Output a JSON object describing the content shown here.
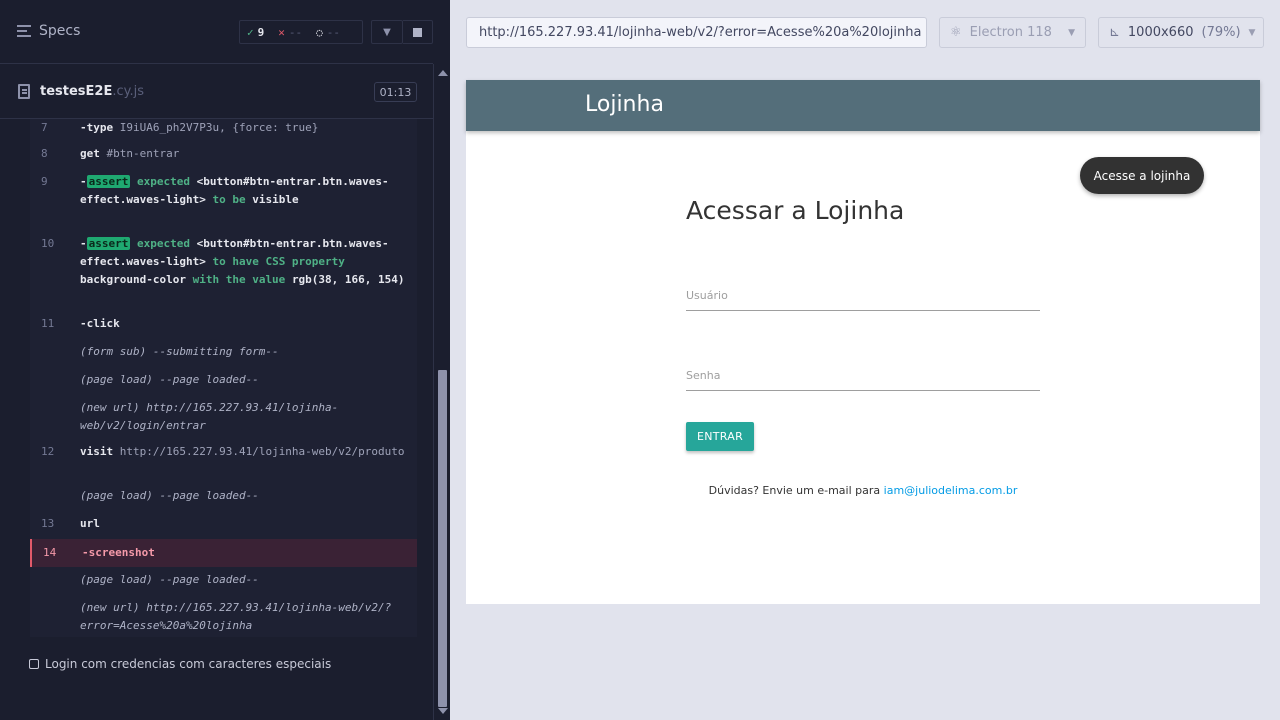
{
  "runner": {
    "specs_label": "Specs",
    "stats": {
      "passed": "9",
      "failed": "--",
      "pending": "--"
    },
    "spec": {
      "name": "testesE2E",
      "ext": ".cy.js",
      "duration": "01:13"
    },
    "test_title": "Login com credencias com caracteres especiais",
    "log": [
      {
        "num": "7",
        "parts": [
          [
            "cmd",
            "-type"
          ],
          [
            "arg",
            "  I9iUA6_ph2V7P3u, {force: true}"
          ]
        ]
      },
      {
        "num": "8",
        "parts": [
          [
            "cmd",
            "get"
          ],
          [
            "arg",
            "  #btn-entrar"
          ]
        ]
      },
      {
        "num": "9",
        "parts": [
          [
            "cmd",
            "-"
          ],
          [
            "assert",
            "assert"
          ],
          [
            "grn",
            "  expected "
          ],
          [
            "wht",
            "<button#btn-entrar.btn.waves-effect.waves-light>"
          ],
          [
            "grn",
            " to be "
          ],
          [
            "wht",
            "visible"
          ]
        ]
      },
      {
        "num": "10",
        "parts": [
          [
            "cmd",
            "-"
          ],
          [
            "assert",
            "assert"
          ],
          [
            "grn",
            "  expected "
          ],
          [
            "wht",
            "<button#btn-entrar.btn.waves-effect.waves-light>"
          ],
          [
            "grn",
            " to have CSS property "
          ],
          [
            "wht",
            "background-color"
          ],
          [
            "grn",
            " with the value "
          ],
          [
            "wht",
            "rgb(38, 166, 154)"
          ]
        ]
      },
      {
        "num": "11",
        "parts": [
          [
            "cmd",
            "-click"
          ]
        ]
      },
      {
        "num": "",
        "parts": [
          [
            "italic",
            "(form sub)  --submitting form--"
          ]
        ]
      },
      {
        "num": "",
        "parts": [
          [
            "italic",
            "(page load)  --page loaded--"
          ]
        ]
      },
      {
        "num": "",
        "parts": [
          [
            "italic",
            "(new url)  http://165.227.93.41/lojinha-web/v2/login/entrar"
          ]
        ]
      },
      {
        "num": "12",
        "parts": [
          [
            "cmd",
            "visit"
          ],
          [
            "arg",
            "  http://165.227.93.41/lojinha-web/v2/produto"
          ]
        ]
      },
      {
        "num": "",
        "parts": [
          [
            "italic",
            "(page load)  --page loaded--"
          ]
        ]
      },
      {
        "num": "13",
        "parts": [
          [
            "cmd",
            "url"
          ]
        ]
      },
      {
        "num": "14",
        "parts": [
          [
            "cmd",
            "-screenshot"
          ]
        ],
        "error": true
      },
      {
        "num": "",
        "parts": [
          [
            "italic",
            "(page load)  --page loaded--"
          ]
        ]
      },
      {
        "num": "",
        "parts": [
          [
            "italic",
            "(new url)  http://165.227.93.41/lojinha-web/v2/?error=Acesse%20a%20lojinha"
          ]
        ]
      }
    ]
  },
  "browser": {
    "url": "http://165.227.93.41/lojinha-web/v2/?error=Acesse%20a%20lojinha",
    "name": "Electron 118",
    "viewport": "1000x660",
    "zoom": "(79%)"
  },
  "app": {
    "brand": "Lojinha",
    "toast": "Acesse a lojinha",
    "title": "Acessar a Lojinha",
    "user_placeholder": "Usuário",
    "pass_placeholder": "Senha",
    "button": "ENTRAR",
    "help_text": "Dúvidas? Envie um e-mail para ",
    "help_email": "iam@juliodelima.com.br"
  },
  "colors": {
    "accent": "#26a69a",
    "navbar": "#546e7a",
    "link": "#039be5"
  }
}
